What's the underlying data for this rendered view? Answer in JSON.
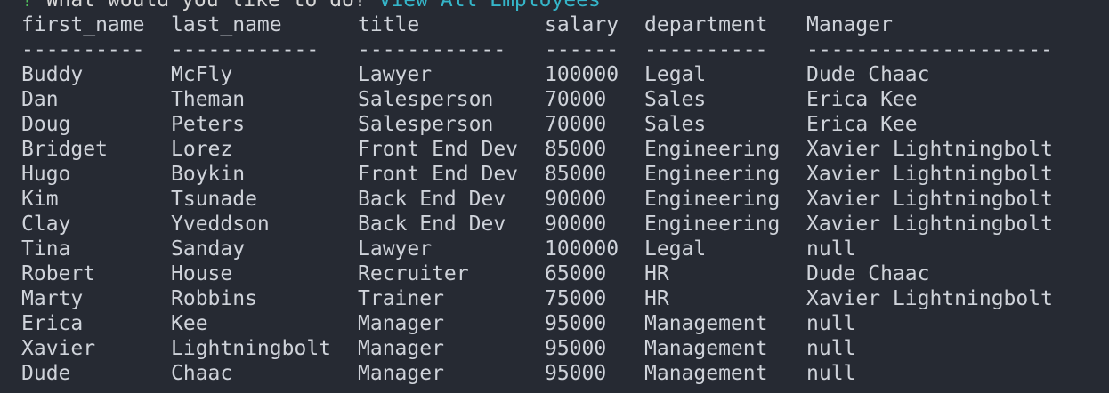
{
  "prompt": {
    "mark": "?",
    "question": "What would you like to do?",
    "answer": "View All Employees"
  },
  "table": {
    "columns": [
      "first_name",
      "last_name",
      "title",
      "salary",
      "department",
      "Manager"
    ],
    "separators": [
      "----------",
      "------------",
      "------------",
      "------",
      "----------",
      "--------------------"
    ],
    "rows": [
      [
        "Buddy",
        "McFly",
        "Lawyer",
        "100000",
        "Legal",
        "Dude Chaac"
      ],
      [
        "Dan",
        "Theman",
        "Salesperson",
        "70000",
        "Sales",
        "Erica Kee"
      ],
      [
        "Doug",
        "Peters",
        "Salesperson",
        "70000",
        "Sales",
        "Erica Kee"
      ],
      [
        "Bridget",
        "Lorez",
        "Front End Dev",
        "85000",
        "Engineering",
        "Xavier Lightningbolt"
      ],
      [
        "Hugo",
        "Boykin",
        "Front End Dev",
        "85000",
        "Engineering",
        "Xavier Lightningbolt"
      ],
      [
        "Kim",
        "Tsunade",
        "Back End Dev",
        "90000",
        "Engineering",
        "Xavier Lightningbolt"
      ],
      [
        "Clay",
        "Yveddson",
        "Back End Dev",
        "90000",
        "Engineering",
        "Xavier Lightningbolt"
      ],
      [
        "Tina",
        "Sanday",
        "Lawyer",
        "100000",
        "Legal",
        "null"
      ],
      [
        "Robert",
        "House",
        "Recruiter",
        "65000",
        "HR",
        "Dude Chaac"
      ],
      [
        "Marty",
        "Robbins",
        "Trainer",
        "75000",
        "HR",
        "Xavier Lightningbolt"
      ],
      [
        "Erica",
        "Kee",
        "Manager",
        "95000",
        "Management",
        "null"
      ],
      [
        "Xavier",
        "Lightningbolt",
        "Manager",
        "95000",
        "Management",
        "null"
      ],
      [
        "Dude",
        "Chaac",
        "Manager",
        "95000",
        "Management",
        "null"
      ]
    ]
  },
  "colors": {
    "background": "#262a33",
    "text": "#cfd3da",
    "prompt_mark": "#4fbf5b",
    "answer": "#35b5c9"
  }
}
